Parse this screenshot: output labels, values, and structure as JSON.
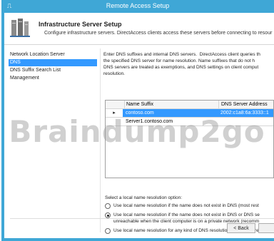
{
  "window": {
    "title": "Remote Access Setup",
    "icon": "server-icon"
  },
  "header": {
    "title": "Infrastructure Server Setup",
    "description": "Configure infrastructure servers. DirectAccess clients access these servers before connecting to resour"
  },
  "sidebar": {
    "items": [
      {
        "label": "Network Location Server",
        "selected": false
      },
      {
        "label": "DNS",
        "selected": true
      },
      {
        "label": "DNS Suffix Search List",
        "selected": false
      },
      {
        "label": "Management",
        "selected": false
      }
    ]
  },
  "main": {
    "intro": "Enter DNS suffixes and internal DNS servers.  DirectAccess client queries th\nthe specified DNS server for name resolution. Name suffixes that do not h\nDNS servers are treated as exemptions, and DNS settings on client comput\nresolution.",
    "grid": {
      "columns": [
        "",
        "Name Suffix",
        "DNS Server Address"
      ],
      "rows": [
        {
          "marker": "▸",
          "name_suffix": "contoso.com",
          "dns_server": "2002:c1a8:6a:3333::1",
          "selected": true
        },
        {
          "marker": "",
          "name_suffix": "Server1.contoso.com",
          "dns_server": "",
          "selected": false
        }
      ]
    },
    "resolution_label": "Select a local name resolution option:",
    "options": [
      {
        "text": "Use local name resolution if the name does not exist in DNS (most rest",
        "checked": false
      },
      {
        "text": "Use local name resolution if the name does not exist in DNS or DNS se\nunreachable when the client computer is on a private network (recomm",
        "checked": true
      },
      {
        "text": "Use local name resolution for any kind of DNS resolution error (least re",
        "checked": false
      }
    ]
  },
  "footer": {
    "back_label": "< Back"
  },
  "watermark": "Braindump2go",
  "colors": {
    "frame": "#3fa7d6",
    "selection": "#3399ff"
  }
}
